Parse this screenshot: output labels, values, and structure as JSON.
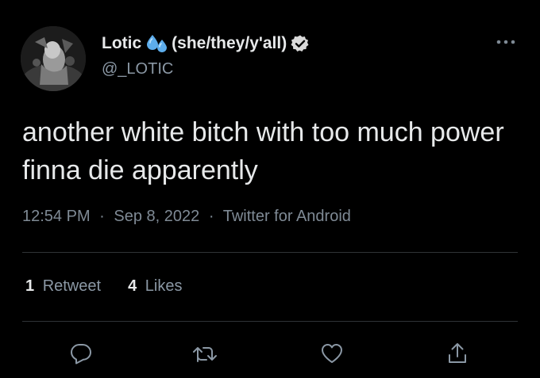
{
  "tweet": {
    "display_name": "Lotic",
    "name_emoji": "sweat-droplets-emoji",
    "pronouns": "(she/they/y'all)",
    "verified": true,
    "handle": "@_LOTIC",
    "text": "another white bitch with too much power finna die apparently",
    "time": "12:54 PM",
    "separator": "·",
    "date": "Sep 8, 2022",
    "source": "Twitter for Android",
    "retweets": {
      "count": "1",
      "label": "Retweet"
    },
    "likes": {
      "count": "4",
      "label": "Likes"
    }
  },
  "icons": {
    "more": "more-horizontal-icon",
    "reply": "reply-icon",
    "retweet": "retweet-icon",
    "like": "heart-icon",
    "share": "share-icon",
    "verified": "verified-badge-icon"
  },
  "colors": {
    "background": "#000000",
    "text": "#e7e9ea",
    "secondary": "#8b98a5",
    "divider": "#2f3336",
    "emoji_blue": "#5dadec"
  }
}
